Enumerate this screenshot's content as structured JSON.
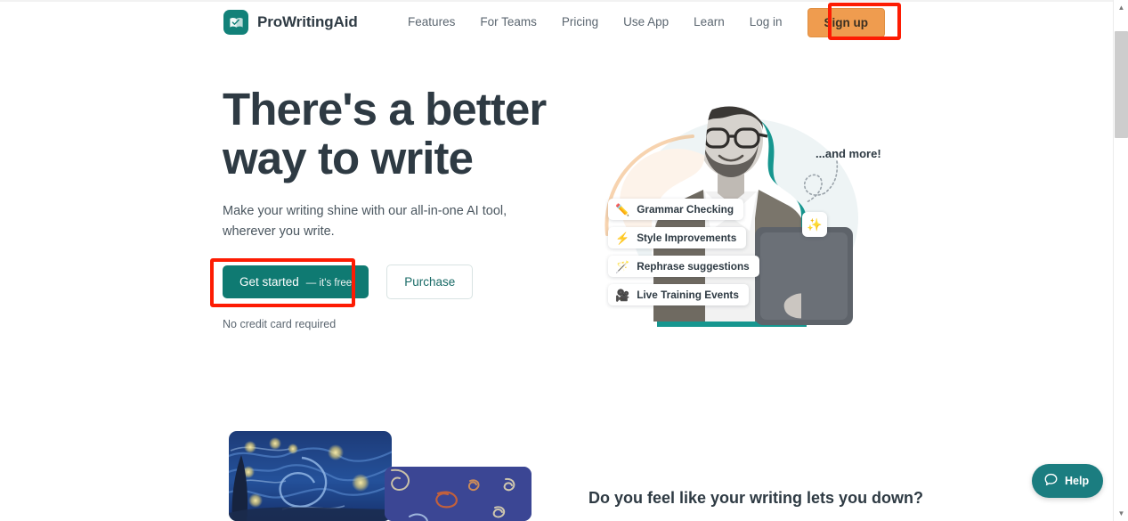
{
  "brand": {
    "name": "ProWritingAid",
    "logo_icon": "book-check-logo-icon",
    "color": "#128179"
  },
  "nav": {
    "items": [
      {
        "label": "Features"
      },
      {
        "label": "For Teams"
      },
      {
        "label": "Pricing"
      },
      {
        "label": "Use App"
      },
      {
        "label": "Learn"
      },
      {
        "label": "Log in"
      }
    ],
    "signup": {
      "label": "Sign up",
      "bg": "#ef9c4f",
      "highlighted": true
    }
  },
  "hero": {
    "title_line1": "There's a better",
    "title_line2": "way to write",
    "subtitle": "Make your writing shine with our all-in-one AI tool, wherever you write.",
    "primary_cta": {
      "label": "Get started",
      "suffix": "— it's free",
      "bg": "#0f7a72",
      "highlighted": true
    },
    "secondary_cta": {
      "label": "Purchase"
    },
    "footnote": "No credit card required"
  },
  "illustration": {
    "and_more_label": "...and more!",
    "sparkle_icon": "sparkles-icon",
    "accent_color": "#1b8c86",
    "chips": [
      {
        "icon": "pencil-icon",
        "emoji": "✏️",
        "label": "Grammar Checking"
      },
      {
        "icon": "lightning-icon",
        "emoji": "⚡",
        "label": "Style Improvements"
      },
      {
        "icon": "magic-wand-icon",
        "emoji": "🪄",
        "label": "Rephrase suggestions"
      },
      {
        "icon": "movie-camera-icon",
        "emoji": "🎥",
        "label": "Live Training Events"
      }
    ]
  },
  "lower_section": {
    "heading": "Do you feel like your writing lets you down?",
    "cards": [
      {
        "name": "starry-night-card"
      },
      {
        "name": "blue-doodle-card",
        "bg": "#3b4694"
      }
    ]
  },
  "help_widget": {
    "label": "Help",
    "icon": "chat-bubble-icon",
    "bg": "#1b7d80"
  },
  "scrollbar": {
    "up_arrow": "▲",
    "down_arrow": "▼"
  },
  "annotations": {
    "color": "#fd1c03"
  }
}
